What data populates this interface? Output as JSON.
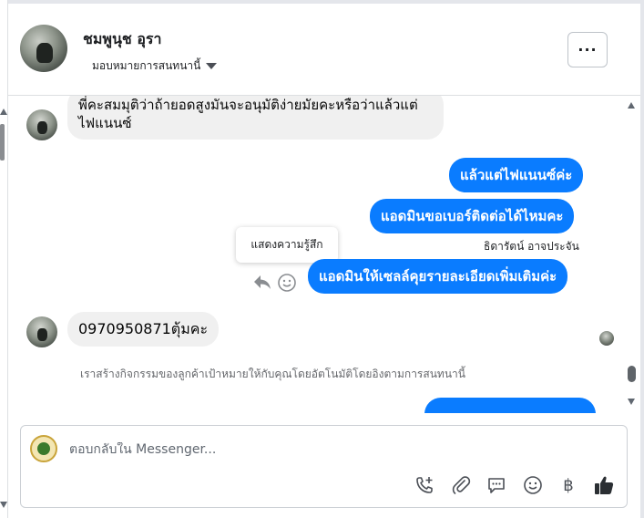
{
  "header": {
    "name": "ชมพูนุช อุรา",
    "assign_label": "มอบหมายการสนทนานี้",
    "more_label": "···"
  },
  "messages": {
    "incoming_1": "พี่คะสมมุติว่าถ้ายอดสูงมันจะอนุมัติง่ายมัยคะหรือว่าแล้วแต่ไฟแนนซ์",
    "outgoing_1": "แล้วแต่ไฟแนนซ์ค่ะ",
    "outgoing_2": "แอดมินขอเบอร์ติดต่อได้ไหมคะ",
    "sender_name": "ธิดารัตน์ อาจประจัน",
    "outgoing_3": "แอดมินให้เซลล์คุยรายละเอียดเพิ่มเติมค่ะ",
    "incoming_2": "0970950871ตุ้มคะ",
    "notice": "เราสร้างกิจกรรมของลูกค้าเป้าหมายให้กับคุณโดยอัตโนมัติโดยอิงตามการสนทนานี้",
    "tooltip": "แสดงความรู้สึก"
  },
  "composer": {
    "placeholder": "ตอบกลับใน Messenger...",
    "currency_symbol": "฿"
  },
  "colors": {
    "outgoing_bubble": "#0a7cff",
    "incoming_bubble": "#f0f0f0"
  },
  "icons": [
    "more-icon",
    "caret-down-icon",
    "reply-icon",
    "reaction-smile-icon",
    "call-add-icon",
    "attach-icon",
    "saved-reply-icon",
    "emoji-icon",
    "baht-icon",
    "like-icon"
  ]
}
